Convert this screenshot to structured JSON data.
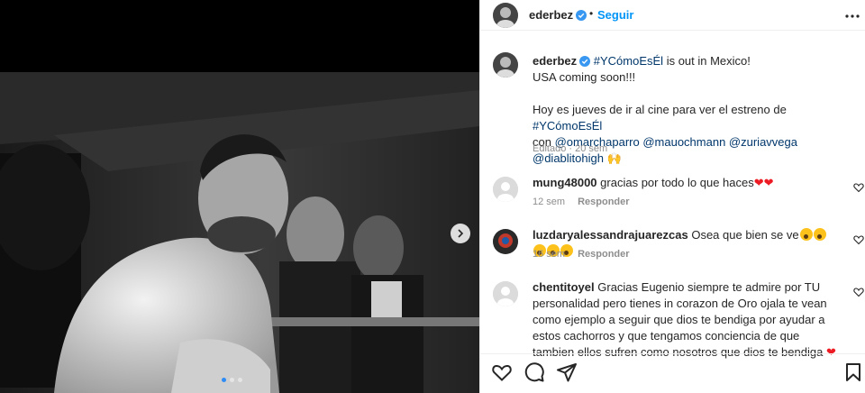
{
  "post": {
    "username": "ederbez",
    "follow_label": "Seguir",
    "separator": "•",
    "caption": {
      "username": "ederbez",
      "hashtag1": "#YCómoEsÉl",
      "line1_rest": " is out in Mexico!",
      "line2": "USA coming soon!!!",
      "line3_start": "Hoy es jueves de ir al cine para ver el estreno de ",
      "hashtag2": "#YCómoEsÉl",
      "line4_start": "con ",
      "mention1": "@omarchaparro",
      "mention2": "@mauochmann",
      "mention3": "@zuriavvega",
      "mention4": "@diablitohigh",
      "emoji": "🙌"
    },
    "meta": "Editado · 20 sem"
  },
  "comments": [
    {
      "username": "mung48000",
      "text": "gracias por todo lo que haces",
      "time": "12 sem",
      "reply": "Responder"
    },
    {
      "username": "luzdaryalessandrajuarezcas",
      "text": "Osea que bien se ve",
      "time": "16 sem",
      "reply": "Responder"
    },
    {
      "username": "chentitoyel",
      "text": "Gracias Eugenio siempre te admire por TU personalidad pero tienes in corazon de Oro ojala te vean como ejemplo a seguir que dios te bendiga por ayudar a estos cachorros y que tengamos conciencia de que tambien ellos sufren como nosotros que dios te bendiga",
      "time": "",
      "reply": ""
    }
  ],
  "colors": {
    "accent": "#0095f6",
    "link": "#00376b",
    "muted": "#8e8e8e",
    "verified": "#3897f0"
  },
  "carousel": {
    "total_slides": 3,
    "active_slide": 1
  }
}
